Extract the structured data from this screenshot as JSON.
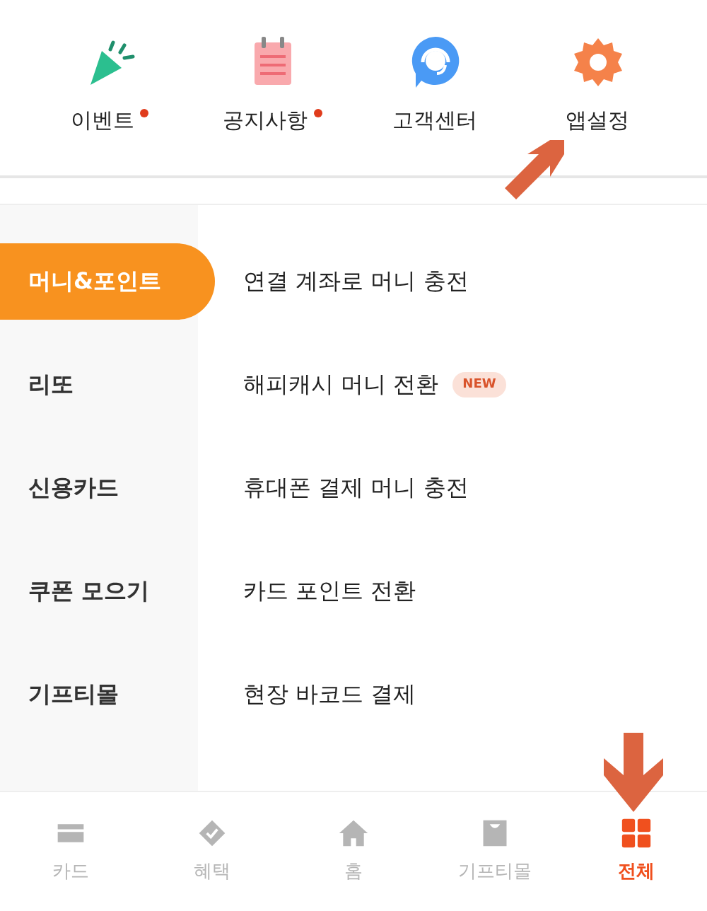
{
  "shortcuts": [
    {
      "kind": "party",
      "label": "이벤트",
      "dot": true
    },
    {
      "kind": "notice",
      "label": "공지사항",
      "dot": true
    },
    {
      "kind": "support",
      "label": "고객센터",
      "dot": false
    },
    {
      "kind": "settings",
      "label": "앱설정",
      "dot": false
    }
  ],
  "sidebar": {
    "items": [
      {
        "label": "머니&포인트",
        "selected": true
      },
      {
        "label": "리또",
        "selected": false
      },
      {
        "label": "신용카드",
        "selected": false
      },
      {
        "label": "쿠폰 모으기",
        "selected": false
      },
      {
        "label": "기프티몰",
        "selected": false
      }
    ]
  },
  "menu": {
    "items": [
      {
        "label": "연결 계좌로 머니 충전"
      },
      {
        "label": "해피캐시 머니 전환",
        "badge": "NEW"
      },
      {
        "label": "휴대폰 결제 머니 충전"
      },
      {
        "label": "카드 포인트 전환"
      },
      {
        "label": "현장 바코드 결제"
      }
    ]
  },
  "bottom_nav": [
    {
      "kind": "card",
      "label": "카드",
      "selected": false
    },
    {
      "kind": "benefit",
      "label": "혜택",
      "selected": false
    },
    {
      "kind": "home",
      "label": "홈",
      "selected": false
    },
    {
      "kind": "shop",
      "label": "기프티몰",
      "selected": false
    },
    {
      "kind": "all",
      "label": "전체",
      "selected": true
    }
  ]
}
